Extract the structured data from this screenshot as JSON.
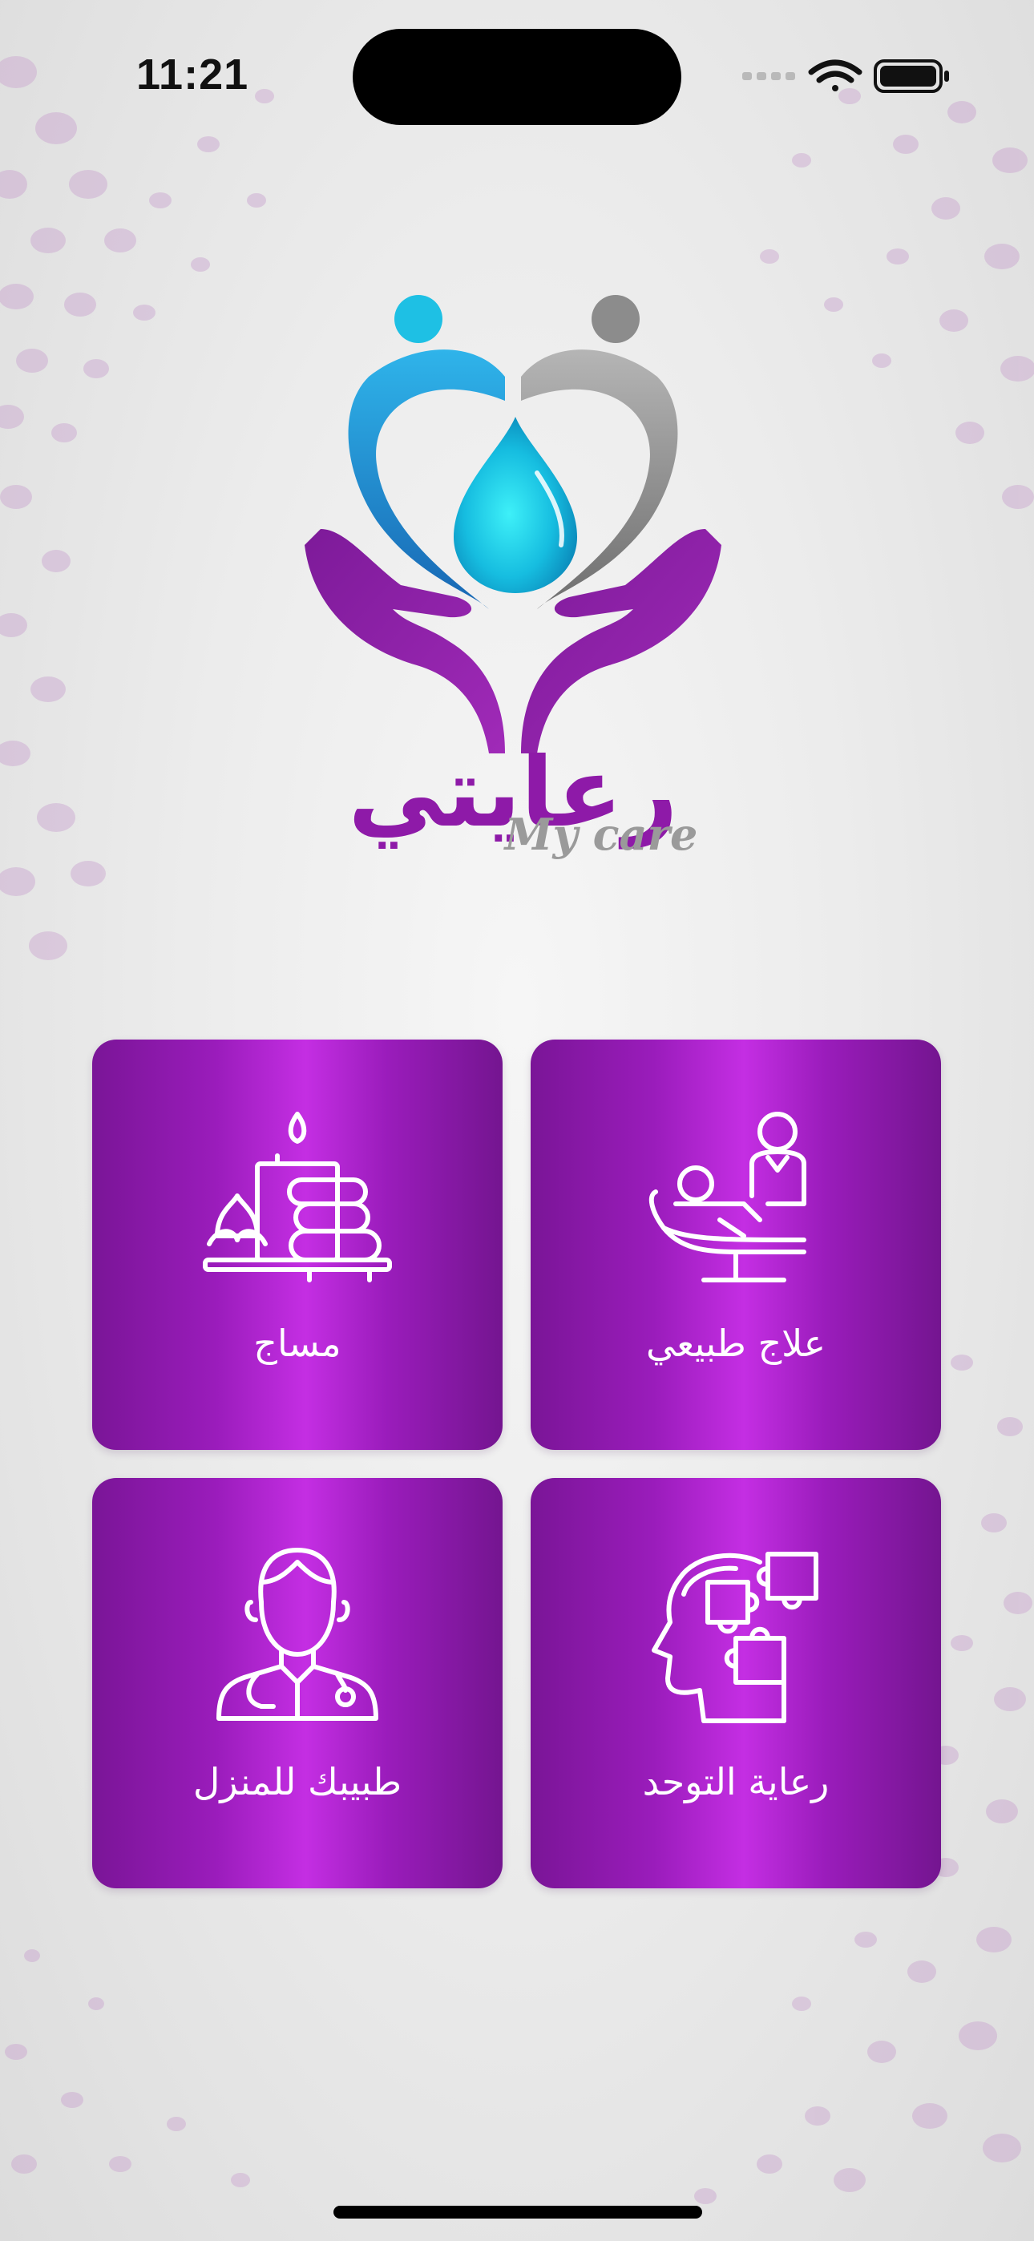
{
  "status_bar": {
    "time": "11:21"
  },
  "brand": {
    "arabic_name": "رعايتي",
    "latin_name": "My care",
    "colors": {
      "purple": "#8e1aa8",
      "cyan": "#12c8e8",
      "blue": "#1f7fc4",
      "gray": "#8a8a8a"
    }
  },
  "services": [
    {
      "label": "مساج",
      "icon": "spa-candle-stones-icon"
    },
    {
      "label": "علاج طبيعي",
      "icon": "physiotherapy-chair-icon"
    },
    {
      "label": "طبيبك للمنزل",
      "icon": "doctor-stethoscope-icon"
    },
    {
      "label": "رعاية التوحد",
      "icon": "head-puzzle-icon"
    }
  ],
  "theme": {
    "tile_gradient_center": "#c42ee3",
    "tile_gradient_edge": "#7a1597",
    "icon_color": "#ffffff"
  }
}
